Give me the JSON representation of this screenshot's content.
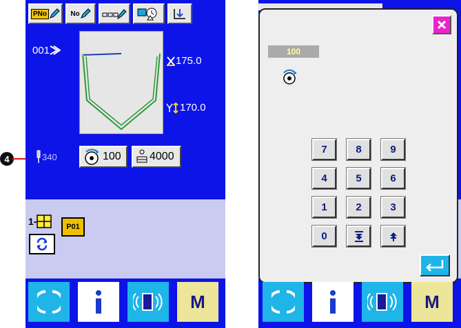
{
  "left": {
    "pattern_no": "001",
    "x_scale": "175.0",
    "y_scale": "170.0",
    "needle_label": "340",
    "speed_value": "100",
    "counter_value": "4000",
    "cycle_prefix": "1-",
    "pattern_tag": "P01",
    "toolbar": {
      "pattern_no_label": "PNo",
      "no_label": "No"
    },
    "callout_number": "4"
  },
  "dialog": {
    "current_value": "100",
    "keys": [
      "7",
      "8",
      "9",
      "4",
      "5",
      "6",
      "1",
      "2",
      "3",
      "0"
    ]
  },
  "colors": {
    "panel_blue": "#0d14e8",
    "lavender": "#c9cbf0",
    "ready_cyan": "#1fb5e8",
    "mode_yellow": "#ece59a",
    "close_magenta": "#ee22cc",
    "key_text": "#0a1a80"
  },
  "bottom_bar": {
    "mode_label": "M"
  }
}
